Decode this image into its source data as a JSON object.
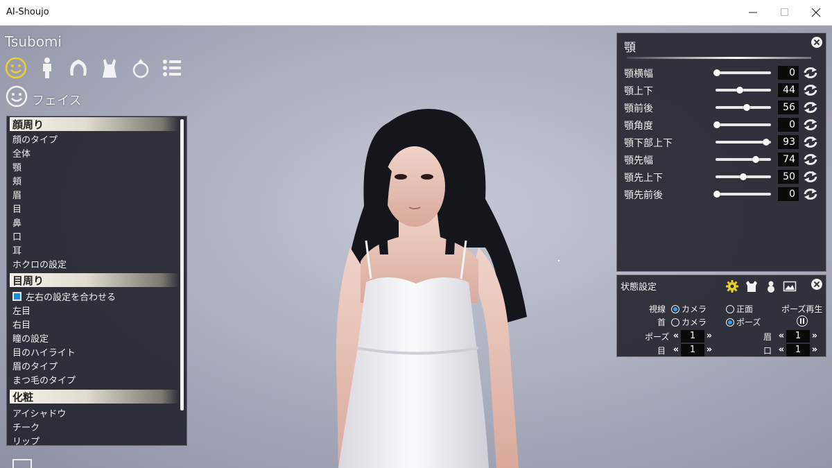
{
  "window": {
    "title": "AI-Shoujo"
  },
  "header": {
    "character_name": "Tsubomi",
    "section_label": "フェイス"
  },
  "categories": [
    {
      "icon": "face-icon",
      "active": true
    },
    {
      "icon": "body-icon",
      "active": false
    },
    {
      "icon": "hair-icon",
      "active": false
    },
    {
      "icon": "clothing-icon",
      "active": false
    },
    {
      "icon": "accessory-ring-icon",
      "active": false
    },
    {
      "icon": "list-menu-icon",
      "active": false
    }
  ],
  "menu": {
    "group1": {
      "label": "顔周り",
      "items": [
        "顔のタイプ",
        "全体",
        "顎",
        "頬",
        "眉",
        "目",
        "鼻",
        "口",
        "耳",
        "ホクロの設定"
      ]
    },
    "group2": {
      "label": "目周り",
      "checkbox": "左右の設定を合わせる",
      "items": [
        "左目",
        "右目",
        "瞳の設定",
        "目のハイライト",
        "眉のタイプ",
        "まつ毛のタイプ"
      ]
    },
    "group3": {
      "label": "化粧",
      "items": [
        "アイシャドウ",
        "チーク",
        "リップ"
      ]
    }
  },
  "jaw_panel": {
    "title": "顎",
    "sliders": [
      {
        "label": "顎横幅",
        "value": 0
      },
      {
        "label": "顎上下",
        "value": 44
      },
      {
        "label": "顎前後",
        "value": 56
      },
      {
        "label": "顎角度",
        "value": 0
      },
      {
        "label": "顎下部上下",
        "value": 93
      },
      {
        "label": "顎先幅",
        "value": 74
      },
      {
        "label": "顎先上下",
        "value": 50
      },
      {
        "label": "顎先前後",
        "value": 0
      }
    ]
  },
  "state_panel": {
    "title": "状態設定",
    "gaze_label": "視線",
    "neck_label": "首",
    "camera_label": "カメラ",
    "front_label": "正面",
    "pose_label": "ポーズ",
    "pose_play_label": "ポーズ再生",
    "steppers": {
      "pose": {
        "label": "ポーズ",
        "value": "1"
      },
      "eyes": {
        "label": "目",
        "value": "1"
      },
      "brow": {
        "label": "眉",
        "value": "1"
      },
      "mouth": {
        "label": "口",
        "value": "1"
      }
    }
  },
  "colors": {
    "accent": "#2aa0f0",
    "active_icon": "#e8d22a"
  }
}
